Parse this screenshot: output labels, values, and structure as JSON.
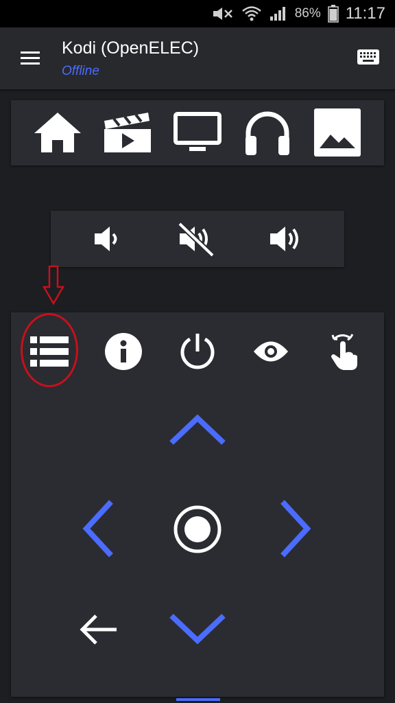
{
  "status_bar": {
    "battery_percent": "86%",
    "time": "11:17",
    "icons": [
      "mute-icon",
      "wifi-icon",
      "signal-icon",
      "battery-icon"
    ]
  },
  "app_bar": {
    "title": "Kodi (OpenELEC)",
    "subtitle": "Offline",
    "icons": [
      "menu-icon",
      "keyboard-icon"
    ]
  },
  "media_sections": {
    "icons": [
      "home-icon",
      "movies-icon",
      "tv-icon",
      "music-icon",
      "pictures-icon"
    ]
  },
  "volume_controls": {
    "icons": [
      "volume-down-icon",
      "mute-icon",
      "volume-up-icon"
    ]
  },
  "remote": {
    "top_icons": [
      "context-menu-icon",
      "info-icon",
      "power-icon",
      "osd-icon",
      "gesture-icon"
    ],
    "dpad_icons": [
      "up-icon",
      "left-icon",
      "select-icon",
      "right-icon",
      "down-icon"
    ],
    "back_icon": "back-icon"
  },
  "colors": {
    "background": "#1c1e21",
    "panel": "#2a2c31",
    "appbar": "#27292d",
    "accent": "#4b6cff",
    "annotation": "#c8101c"
  }
}
